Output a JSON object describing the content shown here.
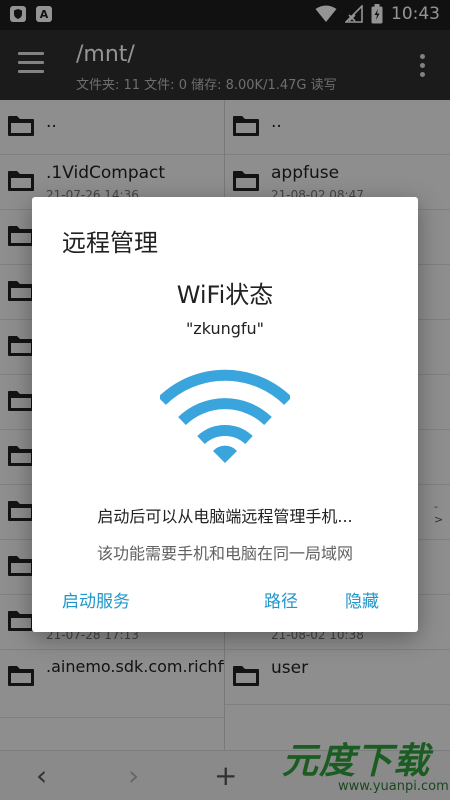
{
  "status_bar": {
    "time": "10:43",
    "left_icons": [
      "shield-icon",
      "a-icon"
    ],
    "right_icons": [
      "wifi-icon",
      "signal-icon",
      "battery-icon"
    ]
  },
  "app_bar": {
    "title": "/mnt/",
    "stats": "文件夹: 11  文件: 0  储存: 8.00K/1.47G  读写"
  },
  "left_pane": {
    "items": [
      {
        "name": "..",
        "date": ""
      },
      {
        "name": ".1VidCompact",
        "date": "21-07-26 14:36"
      },
      {
        "name": "",
        "date": ""
      },
      {
        "name": "",
        "date": ""
      },
      {
        "name": "",
        "date": ""
      },
      {
        "name": "",
        "date": ""
      },
      {
        "name": "",
        "date": ""
      },
      {
        "name": "",
        "date": ""
      },
      {
        "name": "",
        "date": ""
      },
      {
        "name": ".aaa",
        "date": "21-07-28 17:13"
      },
      {
        "name": ".ainemo.sdk.com.richfit.qixin.partybui...",
        "date": ""
      }
    ]
  },
  "right_pane": {
    "items": [
      {
        "name": "..",
        "date": ""
      },
      {
        "name": "appfuse",
        "date": "21-08-02 08:47"
      },
      {
        "name": "",
        "date": ""
      },
      {
        "name": "",
        "date": ""
      },
      {
        "name": "",
        "date": ""
      },
      {
        "name": "",
        "date": ""
      },
      {
        "name": "",
        "date": ""
      },
      {
        "name": "",
        "date": ""
      },
      {
        "name": "",
        "date": "21-08-02 08:22"
      },
      {
        "name": "temp",
        "date": "21-08-02 10:38"
      },
      {
        "name": "user",
        "date": ""
      }
    ],
    "link_arrow": "->"
  },
  "bottom_bar": {
    "back": "‹",
    "forward": "›",
    "add": "+"
  },
  "watermark": {
    "logo": "元度下载",
    "url": "www.yuanpi.com"
  },
  "dialog": {
    "title": "远程管理",
    "wifi_status": "WiFi状态",
    "ssid": "\"zkungfu\"",
    "description": "启动后可以从电脑端远程管理手机...",
    "note": "该功能需要手机和电脑在同一局域网",
    "buttons": {
      "start": "启动服务",
      "path": "路径",
      "hide": "隐藏"
    },
    "accent_color": "#2196c9"
  }
}
